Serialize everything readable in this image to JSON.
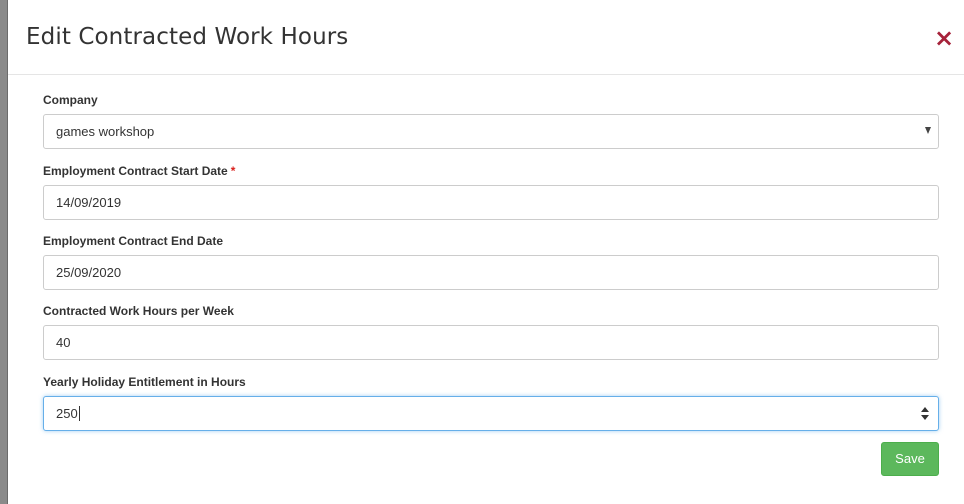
{
  "modal": {
    "title": "Edit Contracted Work Hours",
    "close_icon": "×"
  },
  "form": {
    "company": {
      "label": "Company",
      "value": "games workshop"
    },
    "start_date": {
      "label": "Employment Contract Start Date",
      "required_marker": "*",
      "value": "14/09/2019"
    },
    "end_date": {
      "label": "Employment Contract End Date",
      "value": "25/09/2020"
    },
    "hours_per_week": {
      "label": "Contracted Work Hours per Week",
      "value": "40"
    },
    "holiday_hours": {
      "label": "Yearly Holiday Entitlement in Hours",
      "value": "250"
    }
  },
  "actions": {
    "save_label": "Save"
  },
  "colors": {
    "close": "#a6223a",
    "required": "#d9201c",
    "save_button": "#5cb85c",
    "focus_border": "#66afe9"
  },
  "icons": {
    "close": "close-icon",
    "select": "chevron-down-icon",
    "spinner": "spinner-arrows-icon"
  }
}
